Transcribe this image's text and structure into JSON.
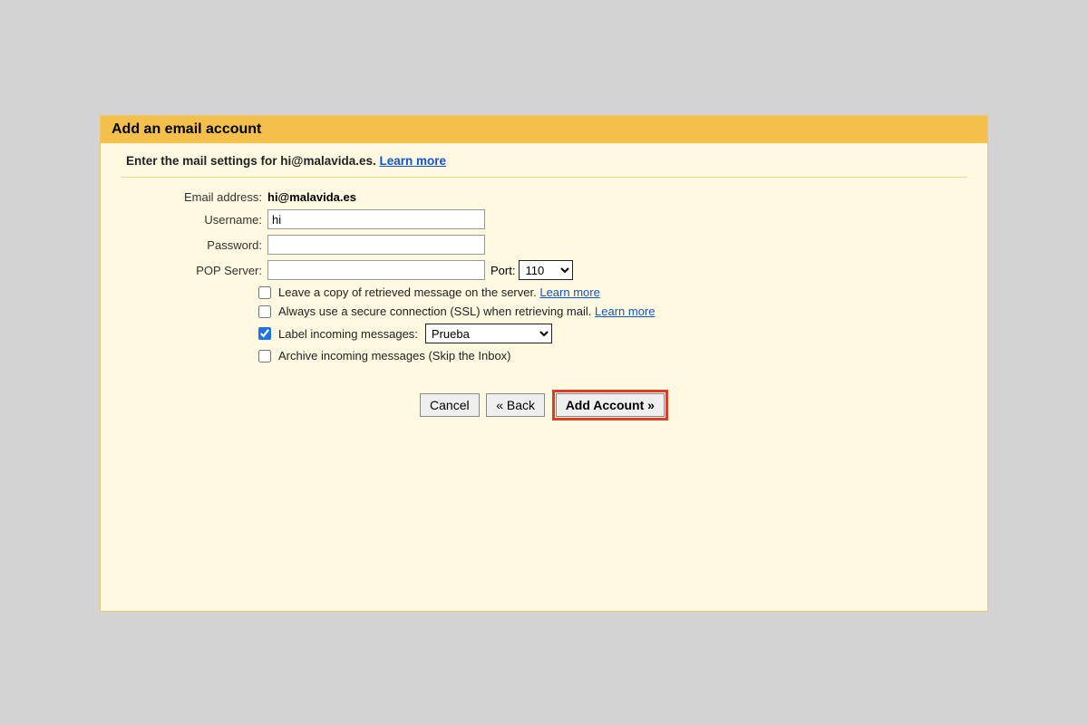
{
  "dialog": {
    "title": "Add an email account",
    "prompt_prefix": "Enter the mail settings for ",
    "prompt_email": "hi@malavida.es",
    "prompt_suffix": ". ",
    "learn_more": "Learn more"
  },
  "form": {
    "email_label": "Email address:",
    "email_value": "hi@malavida.es",
    "username_label": "Username:",
    "username_value": "hi",
    "password_label": "Password:",
    "password_value": "",
    "pop_label": "POP Server:",
    "pop_value": "",
    "port_label": "Port:",
    "port_value": "110"
  },
  "options": {
    "leave_copy": {
      "checked": false,
      "text": "Leave a copy of retrieved message on the server. ",
      "link": "Learn more"
    },
    "ssl": {
      "checked": false,
      "text": "Always use a secure connection (SSL) when retrieving mail. ",
      "link": "Learn more"
    },
    "label": {
      "checked": true,
      "text": "Label incoming messages: ",
      "select_value": "Prueba"
    },
    "archive": {
      "checked": false,
      "text": "Archive incoming messages (Skip the Inbox)"
    }
  },
  "buttons": {
    "cancel": "Cancel",
    "back": "« Back",
    "add": "Add Account »"
  }
}
